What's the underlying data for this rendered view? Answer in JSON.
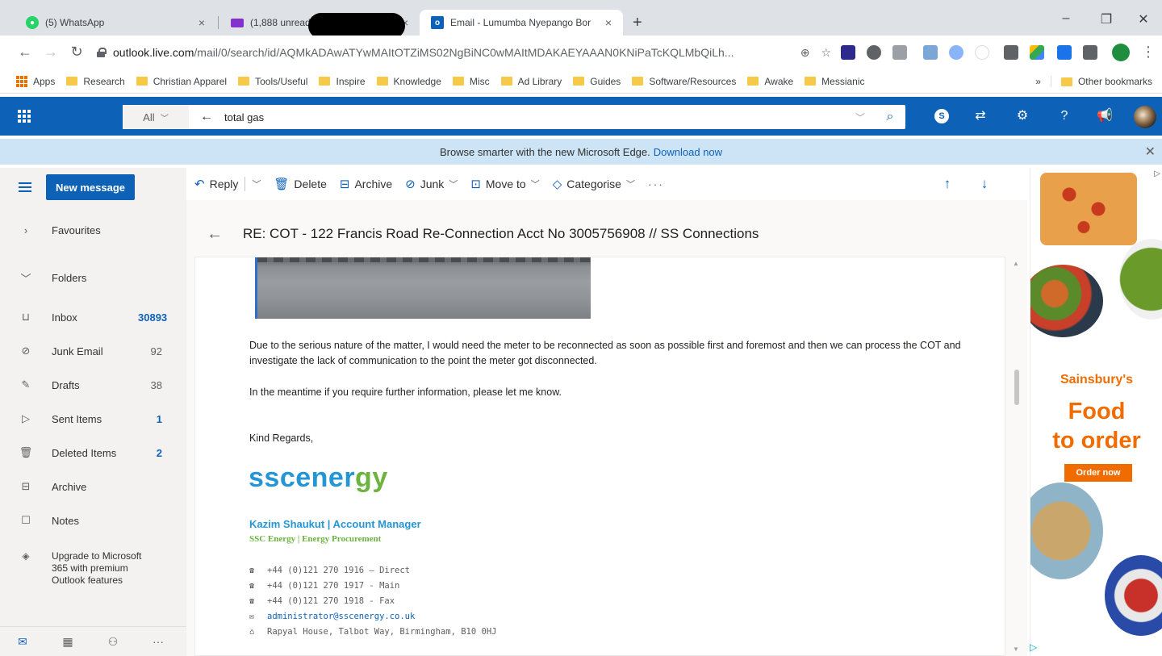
{
  "browser": {
    "tabs": [
      {
        "title": "(5) WhatsApp",
        "active": false,
        "icon": "whatsapp-icon",
        "color": "#25d366"
      },
      {
        "title": "(1,888 unread",
        "active": false,
        "icon": "mail-icon",
        "color": "#8430ce"
      },
      {
        "title": "Email - Lumumba Nyepango Bor",
        "active": true,
        "icon": "outlook-icon",
        "color": "#0d62b8"
      }
    ],
    "url_host": "outlook.live.com",
    "url_path": "/mail/0/search/id/AQMkADAwATYwMAItOTZiMS02NgBiNC0wMAItMDAKAEYAAAN0KNiPaTcKQLMbQiLh...",
    "bookmarks": [
      "Apps",
      "Research",
      "Christian Apparel",
      "Tools/Useful",
      "Inspire",
      "Knowledge",
      "Misc",
      "Ad Library",
      "Guides",
      "Software/Resources",
      "Awake",
      "Messianic"
    ],
    "bookmarks_overflow": "»",
    "other_bookmarks": "Other bookmarks"
  },
  "outlook": {
    "search": {
      "scope": "All",
      "query": "total gas"
    },
    "banner": {
      "text": "Browse smarter with the new Microsoft Edge.",
      "link": "Download now"
    },
    "new_message": "New message",
    "nav": [
      {
        "label": "Favourites",
        "icon": "chevron-right-icon",
        "count": "",
        "bold": false
      },
      {
        "label": "Folders",
        "icon": "chevron-down-icon",
        "count": "",
        "bold": false
      },
      {
        "label": "Inbox",
        "icon": "inbox-icon",
        "count": "30893",
        "highlight": true
      },
      {
        "label": "Junk Email",
        "icon": "junk-icon",
        "count": "92",
        "highlight": false
      },
      {
        "label": "Drafts",
        "icon": "pencil-icon",
        "count": "38",
        "highlight": false
      },
      {
        "label": "Sent Items",
        "icon": "send-icon",
        "count": "1",
        "highlight": true
      },
      {
        "label": "Deleted Items",
        "icon": "trash-icon",
        "count": "2",
        "highlight": true
      },
      {
        "label": "Archive",
        "icon": "archive-icon",
        "count": "",
        "highlight": false
      },
      {
        "label": "Notes",
        "icon": "note-icon",
        "count": "",
        "highlight": false
      }
    ],
    "upgrade": "Upgrade to Microsoft 365 with premium Outlook features",
    "commands": {
      "reply": "Reply",
      "delete": "Delete",
      "archive": "Archive",
      "junk": "Junk",
      "move_to": "Move to",
      "categorise": "Categorise",
      "more": "···"
    },
    "message": {
      "subject": "RE: COT - 122 Francis Road Re-Connection Acct No 3005756908 // SS Connections",
      "para1": "Due to the serious nature of the matter, I would need the meter to be reconnected as soon as possible first and foremost and then we can process the COT and investigate the lack of communication to the point the meter got disconnected.",
      "para2": "In the meantime if you require further information, please let me know.",
      "closing": "Kind Regards,",
      "logo_main": "sscener",
      "logo_accent": "gy",
      "sig_name": "Kazim Shaukut | Account Manager",
      "sig_role": "SSC Energy | Energy Procurement",
      "contacts": [
        {
          "icon": "phone-icon",
          "text": "+44 (0)121 270 1916 – Direct",
          "link": false
        },
        {
          "icon": "phone-icon",
          "text": "+44 (0)121 270 1917 - Main",
          "link": false
        },
        {
          "icon": "phone-icon",
          "text": "+44 (0)121 270 1918 - Fax",
          "link": false
        },
        {
          "icon": "email-icon",
          "text": "administrator@sscenergy.co.uk",
          "link": true
        },
        {
          "icon": "address-icon",
          "text": "Rapyal House, Talbot Way, Birmingham, B10 0HJ",
          "link": false
        }
      ]
    }
  },
  "ad": {
    "brand": "Sainsbury's",
    "headline_1": "Food",
    "headline_2": "to order",
    "button": "Order now",
    "color": "#f06c00"
  }
}
